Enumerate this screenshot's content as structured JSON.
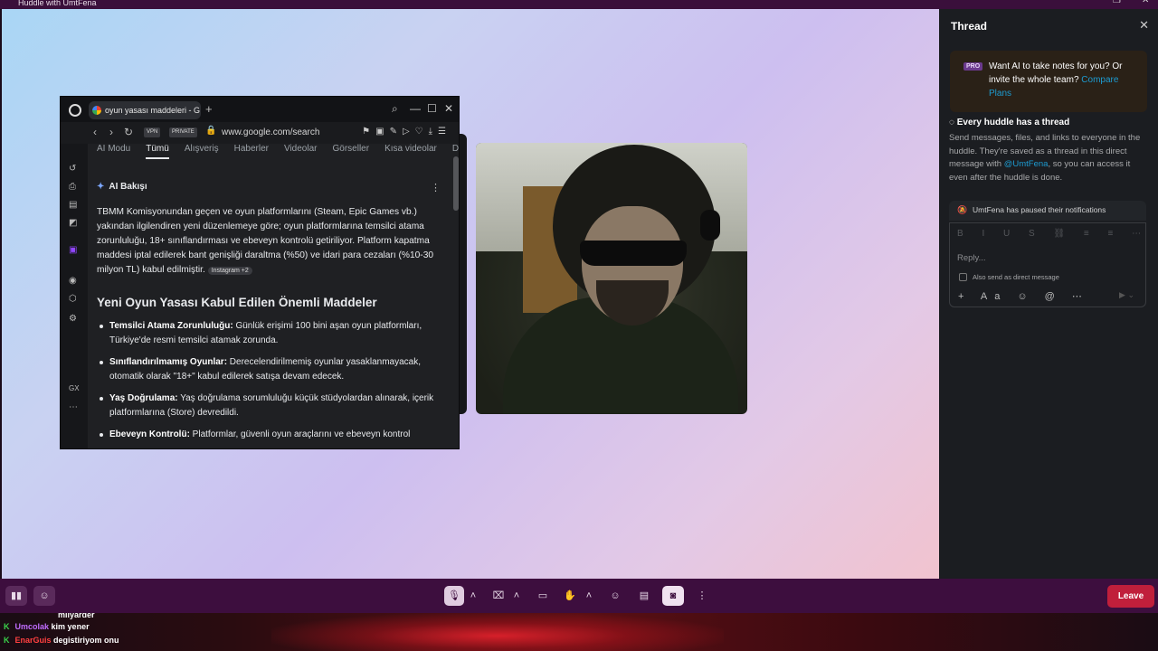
{
  "window": {
    "title": "Huddle with UmtFena"
  },
  "browser": {
    "tab_title": "oyun yasası maddeleri - G",
    "url": "www.google.com/search",
    "vpn_label": "VPN",
    "private_label": "PRIVATE",
    "search_tabs": [
      "AI Modu",
      "Tümü",
      "Alışveriş",
      "Haberler",
      "Videolar",
      "Görseller",
      "Kısa videolar",
      "Da"
    ],
    "active_tab": "Tümü",
    "ai_overview_title": "AI Bakışı",
    "overview_text": "TBMM Komisyonundan geçen ve oyun platformlarını (Steam, Epic Games vb.) yakından ilgilendiren yeni düzenlemeye göre; oyun platformlarına temsilci atama zorunluluğu, 18+ sınıflandırması ve ebeveyn kontrolü getiriliyor. Platform kapatma maddesi iptal edilerek bant genişliği daraltma (%50) ve idari para cezaları (%10-30 milyon TL) kabul edilmiştir.",
    "source_chip": "Instagram +2",
    "heading": "Yeni Oyun Yasası Kabul Edilen Önemli Maddeler",
    "bullets": [
      {
        "title": "Temsilci Atama Zorunluluğu:",
        "text": " Günlük erişimi 100 bini aşan oyun platformları, Türkiye'de resmi temsilci atamak zorunda."
      },
      {
        "title": "Sınıflandırılmamış Oyunlar:",
        "text": " Derecelendirilmemiş oyunlar yasaklanmayacak, otomatik olarak \"18+\" kabul edilerek satışa devam edecek."
      },
      {
        "title": "Yaş Doğrulama:",
        "text": " Yaş doğrulama sorumluluğu küçük stüdyolardan alınarak, içerik platformlarına (Store) devredildi."
      },
      {
        "title": "Ebeveyn Kontrolü:",
        "text": " Platformlar, güvenli oyun araçlarını ve ebeveyn kontrol"
      }
    ]
  },
  "thread": {
    "title": "Thread",
    "promo_badge": "PRO",
    "promo_text": "Want AI to take notes for you? Or invite the whole team?",
    "promo_link": "Compare Plans",
    "huddle_heading": "Every huddle has a thread",
    "huddle_desc_1": "Send messages, files, and links to everyone in the huddle. They're saved as a thread in this direct message with",
    "huddle_mention": "@UmtFena",
    "huddle_desc_2": ", so you can access it even after the huddle is done.",
    "paused_notice": "UmtFena has paused their notifications",
    "reply_placeholder": "Reply...",
    "direct_message_label": "Also send as direct message"
  },
  "controls": {
    "leave_label": "Leave"
  },
  "chat": [
    {
      "user": "",
      "message": "milyarder",
      "color": "#ffffff"
    },
    {
      "user": "Umcolak",
      "message": "kim yener",
      "color": "#c06cff"
    },
    {
      "user": "EnarGuis",
      "message": "degistiriyom onu",
      "color": "#ff4040"
    }
  ],
  "colors": {
    "leave": "#c01f3b",
    "bar": "#3d0e3e",
    "accent_link": "#1d9bd1",
    "twitch": "#9146ff"
  }
}
